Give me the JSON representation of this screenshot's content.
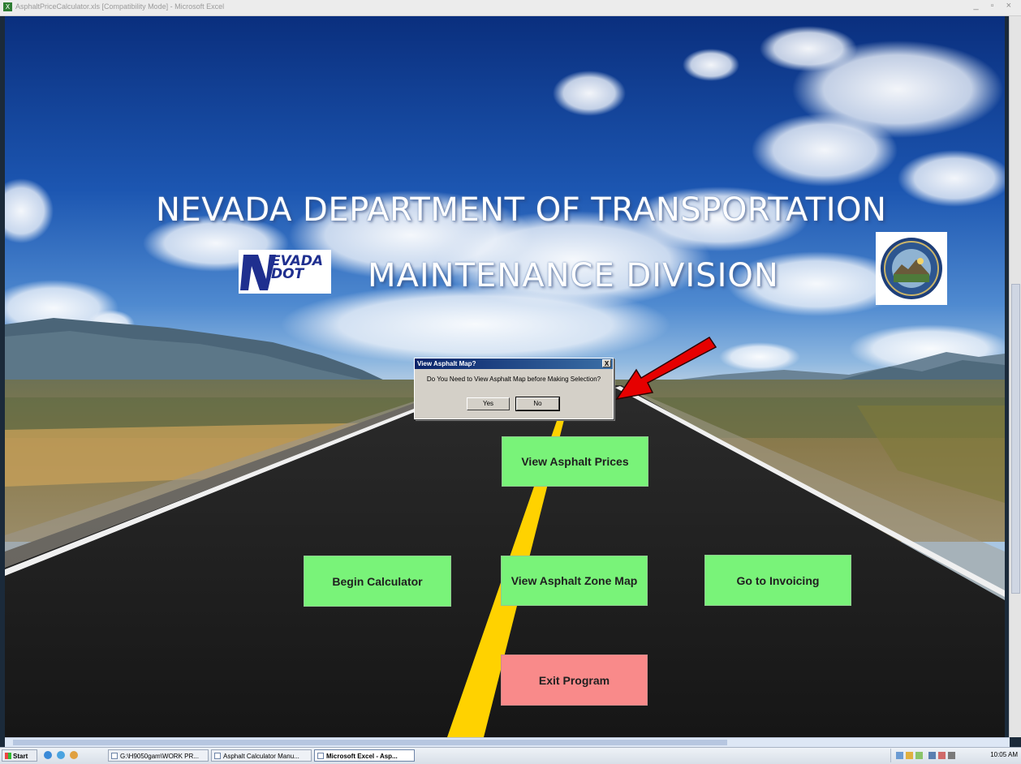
{
  "window": {
    "title": "AsphaltPriceCalculator.xls  [Compatibility Mode] - Microsoft Excel",
    "controls": "_ ▫ ×"
  },
  "header": {
    "title": "NEVADA DEPARTMENT OF TRANSPORTATION",
    "subtitle": "MAINTENANCE DIVISION",
    "logo_line1": "EVADA",
    "logo_line2": "DOT"
  },
  "buttons": {
    "view_prices": "View Asphalt Prices",
    "begin_calculator": "Begin Calculator",
    "view_zone_map": "View Asphalt Zone Map",
    "go_invoicing": "Go to Invoicing",
    "exit_program": "Exit Program"
  },
  "dialog": {
    "title": "View Asphalt Map?",
    "message": "Do You Need to View Asphalt Map before Making Selection?",
    "yes_label": "Yes",
    "no_label": "No",
    "close_label": "X"
  },
  "taskbar": {
    "start_label": "Start",
    "tasks": [
      {
        "label": "G:\\H9050gam\\WORK PR..."
      },
      {
        "label": "Asphalt Calculator Manu..."
      },
      {
        "label": "Microsoft Excel - Asp..."
      }
    ],
    "clock": "10:05 AM"
  },
  "colors": {
    "action_button": "#79f379",
    "exit_button": "#f98a8a",
    "arrow": "#e60000",
    "dialog_title": "#0a246a"
  }
}
